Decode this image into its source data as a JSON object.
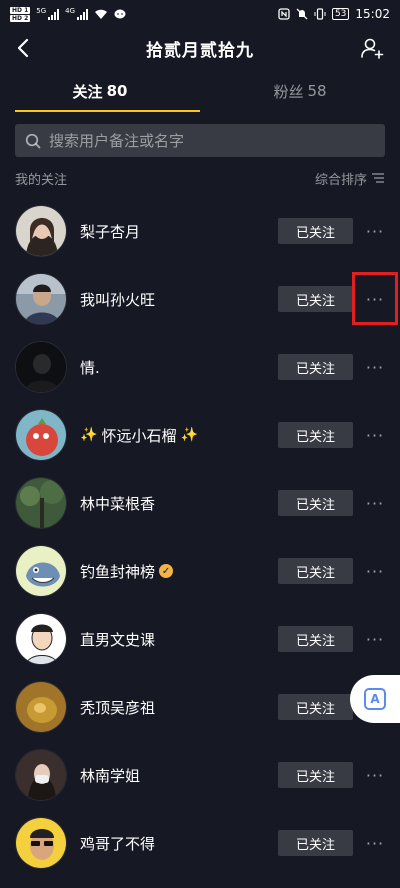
{
  "status_bar": {
    "hd1": "HD 1",
    "hd2": "HD 2",
    "net1": "5G",
    "net2": "4G",
    "battery": "53",
    "time": "15:02"
  },
  "header": {
    "title": "拾贰月贰拾九"
  },
  "tabs": [
    {
      "label": "关注",
      "count": "80"
    },
    {
      "label": "粉丝",
      "count": "58"
    }
  ],
  "search": {
    "placeholder": "搜索用户备注或名字"
  },
  "section": {
    "label": "我的关注",
    "sort_label": "综合排序"
  },
  "follow_button_label": "已关注",
  "more_label": "···",
  "users": [
    {
      "name": "梨子杏月"
    },
    {
      "name": "我叫孙火旺"
    },
    {
      "name": "情."
    },
    {
      "name": "怀远小石榴"
    },
    {
      "name": "林中菜根香"
    },
    {
      "name": "钓鱼封神榜"
    },
    {
      "name": "直男文史课"
    },
    {
      "name": "秃顶吴彦祖"
    },
    {
      "name": "林南学姐"
    },
    {
      "name": "鸡哥了不得"
    }
  ],
  "floating_button": {
    "label": "A"
  },
  "colors": {
    "background": "#161823",
    "tab_underline": "#fdc41a",
    "button_bg": "#393b44",
    "highlight": "#e02020"
  }
}
